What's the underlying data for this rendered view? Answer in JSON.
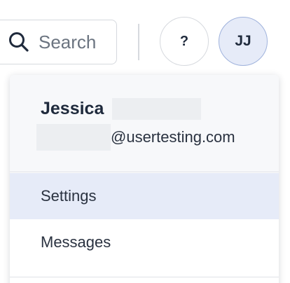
{
  "header": {
    "search": {
      "placeholder": "Search",
      "icon": "search-icon"
    },
    "help_button": {
      "label": "?"
    },
    "avatar": {
      "initials": "JJ",
      "accent_color": "#e6ebf8",
      "border_color": "#9fb2dc"
    }
  },
  "account_menu": {
    "user": {
      "first_name": "Jessica",
      "email_domain": "@usertesting.com"
    },
    "items": [
      {
        "label": "Settings",
        "highlighted": true
      },
      {
        "label": "Messages",
        "highlighted": false
      }
    ],
    "highlight_color": "#e6ebf8"
  }
}
